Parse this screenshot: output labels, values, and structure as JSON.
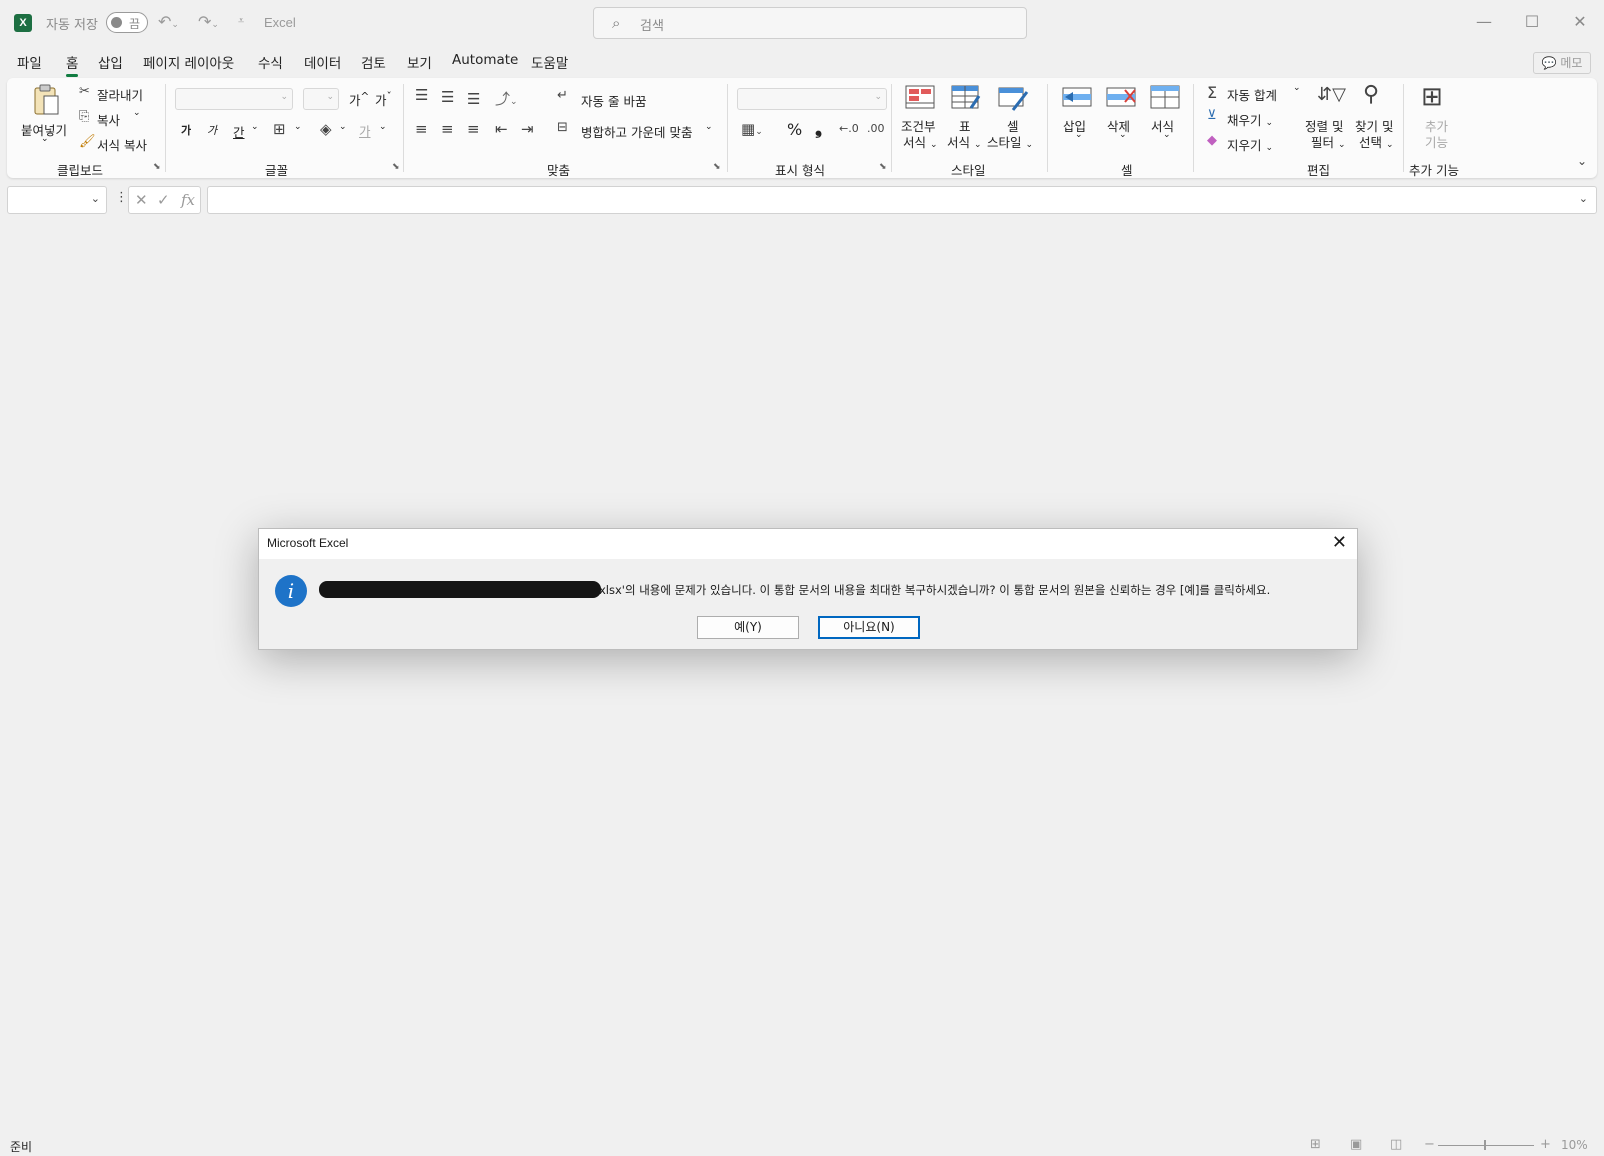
{
  "titlebar": {
    "logo": "X",
    "autosave_label": "자동 저장",
    "toggle_state": "끔",
    "app_name": "Excel",
    "search_placeholder": "검색"
  },
  "tabs": [
    "파일",
    "홈",
    "삽입",
    "페이지 레이아웃",
    "수식",
    "데이터",
    "검토",
    "보기",
    "Automate",
    "도움말"
  ],
  "memo_button": "메모",
  "ribbon": {
    "clipboard": {
      "paste": "붙여넣기",
      "cut": "잘라내기",
      "copy": "복사",
      "format_painter": "서식 복사",
      "label": "클립보드"
    },
    "font": {
      "grow": "가",
      "shrink": "가",
      "bold": "가",
      "italic": "가",
      "underline": "간",
      "font_color": "가",
      "label": "글꼴"
    },
    "alignment": {
      "wrap_text": "자동 줄 바꿈",
      "merge_center": "병합하고 가운데 맞춤",
      "label": "맞춤"
    },
    "number": {
      "percent": "%",
      "comma": "❟",
      "label": "표시 형식"
    },
    "styles": {
      "conditional_1": "조건부",
      "conditional_2": "서식",
      "table_1": "표",
      "table_2": "서식",
      "cell_style_1": "셀",
      "cell_style_2": "스타일",
      "label": "스타일"
    },
    "cells": {
      "insert": "삽입",
      "delete": "삭제",
      "format": "서식",
      "label": "셀"
    },
    "editing": {
      "autosum": "자동 합계",
      "fill": "채우기",
      "clear": "지우기",
      "sort_1": "정렬 및",
      "sort_2": "필터",
      "find_1": "찾기 및",
      "find_2": "선택",
      "label": "편집"
    },
    "addins": {
      "addins_1": "추가",
      "addins_2": "기능",
      "label": "추가 기능"
    }
  },
  "dialog": {
    "title": "Microsoft Excel",
    "message": "xlsx'의 내용에 문제가 있습니다. 이 통합 문서의 내용을 최대한 복구하시겠습니까? 이 통합 문서의 원본을 신뢰하는 경우 [예]를 클릭하세요.",
    "yes_button": "예(Y)",
    "no_button": "아니요(N)"
  },
  "status": {
    "ready": "준비",
    "zoom": "10%"
  }
}
